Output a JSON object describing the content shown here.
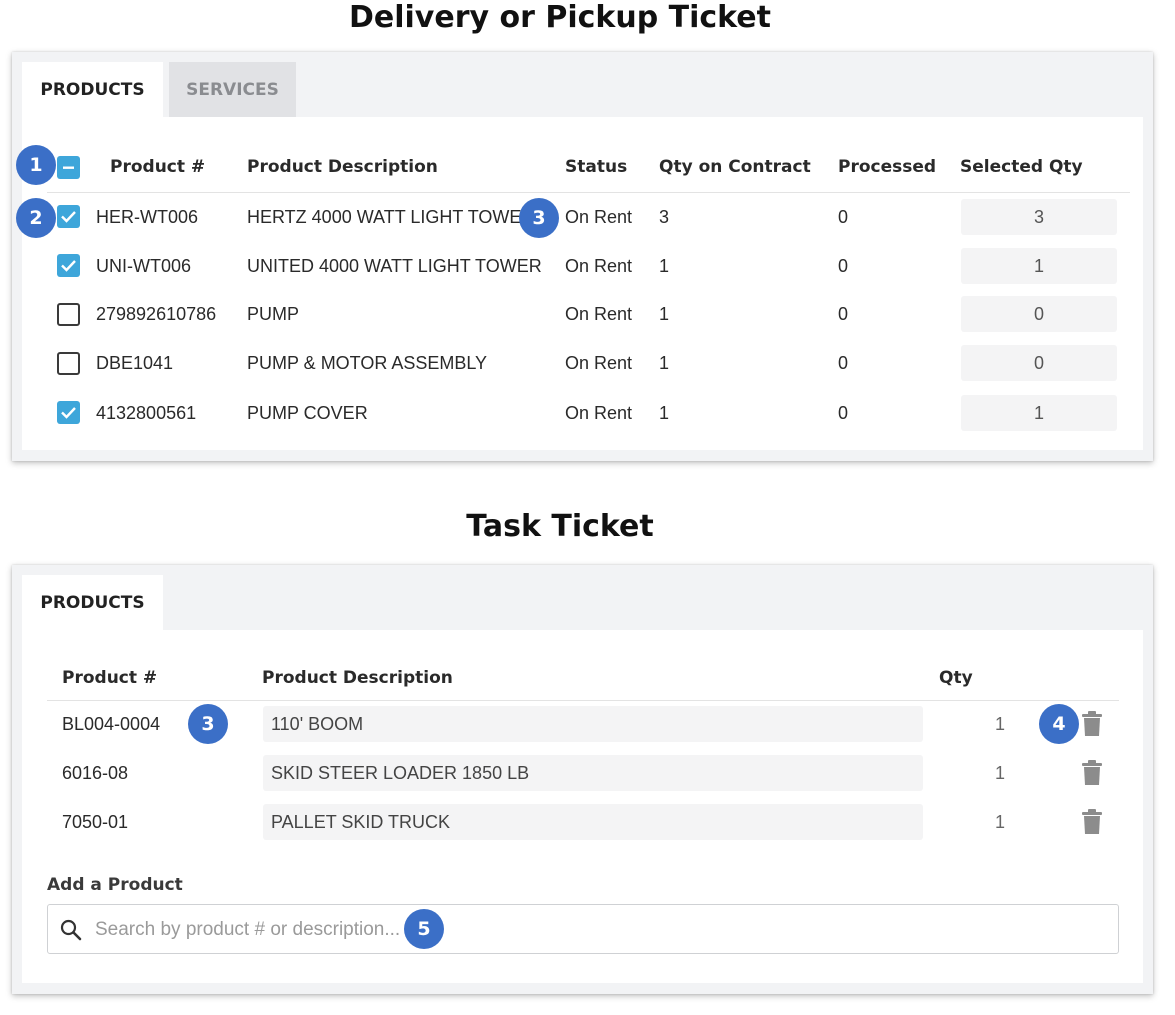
{
  "delivery": {
    "title": "Delivery or Pickup Ticket",
    "tabs": [
      {
        "label": "PRODUCTS",
        "active": true
      },
      {
        "label": "SERVICES",
        "active": false
      }
    ],
    "columns": [
      "Product #",
      "Product Description",
      "Status",
      "Qty on Contract",
      "Processed",
      "Selected Qty"
    ],
    "rows": [
      {
        "checked": true,
        "product": "HER-WT006",
        "description": "HERTZ 4000 WATT LIGHT TOWER",
        "status": "On Rent",
        "qty_on_contract": "3",
        "processed": "0",
        "selected_qty": "3"
      },
      {
        "checked": true,
        "product": "UNI-WT006",
        "description": "UNITED 4000 WATT LIGHT TOWER",
        "status": "On Rent",
        "qty_on_contract": "1",
        "processed": "0",
        "selected_qty": "1"
      },
      {
        "checked": false,
        "product": "279892610786",
        "description": "PUMP",
        "status": "On Rent",
        "qty_on_contract": "1",
        "processed": "0",
        "selected_qty": "0"
      },
      {
        "checked": false,
        "product": "DBE1041",
        "description": "PUMP & MOTOR ASSEMBLY",
        "status": "On Rent",
        "qty_on_contract": "1",
        "processed": "0",
        "selected_qty": "0"
      },
      {
        "checked": true,
        "product": "4132800561",
        "description": "PUMP COVER",
        "status": "On Rent",
        "qty_on_contract": "1",
        "processed": "0",
        "selected_qty": "1"
      }
    ],
    "callouts": {
      "select_all": "1",
      "row_check": "2",
      "status": "3"
    }
  },
  "task": {
    "title": "Task Ticket",
    "tabs": [
      {
        "label": "PRODUCTS",
        "active": true
      }
    ],
    "columns": [
      "Product #",
      "Product Description",
      "Qty"
    ],
    "rows": [
      {
        "product": "BL004-0004",
        "description": "110' BOOM",
        "qty": "1"
      },
      {
        "product": "6016-08",
        "description": "SKID STEER LOADER 1850 LB",
        "qty": "1"
      },
      {
        "product": "7050-01",
        "description": "PALLET SKID TRUCK",
        "qty": "1"
      }
    ],
    "add_product_label": "Add a Product",
    "search_placeholder": "Search by product # or description...",
    "callouts": {
      "product": "3",
      "delete": "4",
      "search": "5"
    }
  },
  "colors": {
    "accent": "#3ea6da",
    "callout": "#3b6fc7",
    "trash": "#8c8c8c"
  },
  "icons": {
    "checkbox": "checkmark-icon",
    "delete": "trash-icon",
    "search": "search-icon"
  }
}
